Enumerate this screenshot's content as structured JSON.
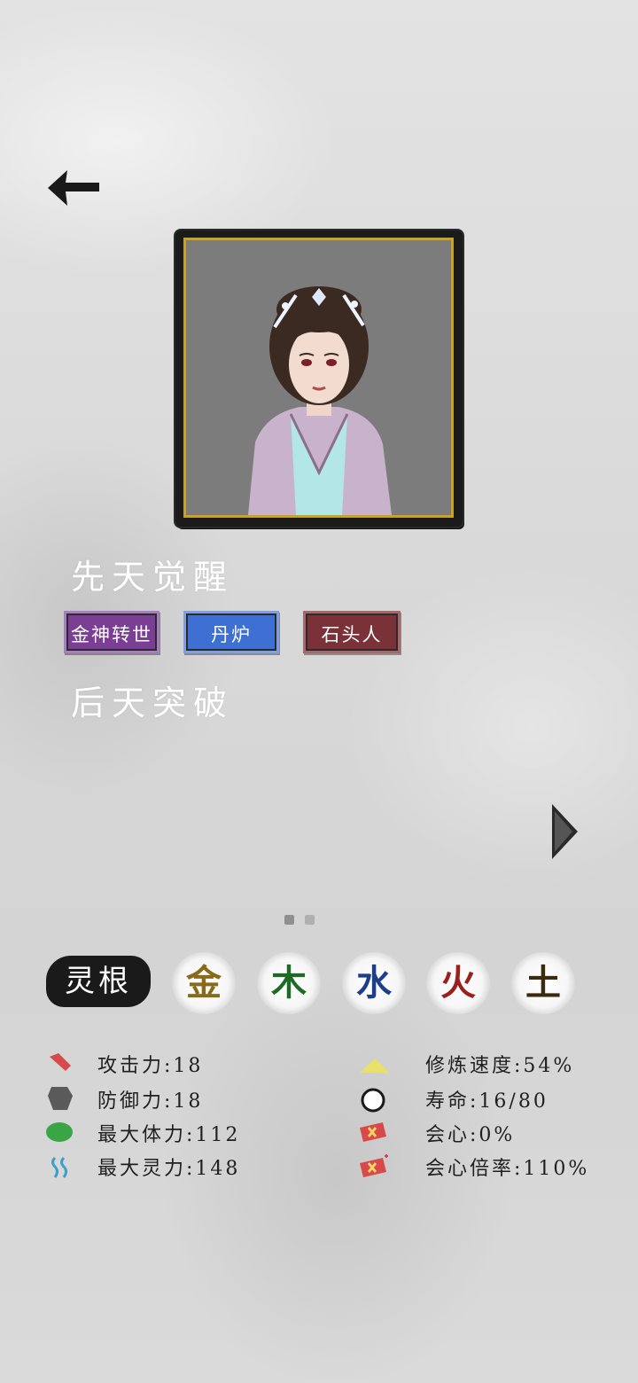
{
  "profile": {
    "innate_title": "先天觉醒",
    "acquired_title": "后天突破",
    "innate_traits": [
      {
        "label": "金神转世",
        "color": "#7a3f95"
      },
      {
        "label": "丹炉",
        "color": "#3e6fd2"
      },
      {
        "label": "石头人",
        "color": "#7a3238"
      }
    ]
  },
  "pager": {
    "current": 1,
    "total": 2
  },
  "spirit_root": {
    "label": "灵根",
    "elements": [
      {
        "char": "金",
        "color": "#8a6a1a"
      },
      {
        "char": "木",
        "color": "#1f6a24"
      },
      {
        "char": "水",
        "color": "#1c3f8c"
      },
      {
        "char": "火",
        "color": "#9a1f1f"
      },
      {
        "char": "土",
        "color": "#3a2a10"
      }
    ]
  },
  "stats": {
    "left": [
      {
        "label": "攻击力:18",
        "icon": "sword-icon",
        "icon_color": "#d84a4a"
      },
      {
        "label": "防御力:18",
        "icon": "shield-icon",
        "icon_color": "#5a5a5a"
      },
      {
        "label": "最大体力:112",
        "icon": "health-icon",
        "icon_color": "#3aa544"
      },
      {
        "label": "最大灵力:148",
        "icon": "spirit-energy-icon",
        "icon_color": "#3aa0c8"
      }
    ],
    "right": [
      {
        "label": "修炼速度:54%",
        "icon": "cultivation-speed-icon",
        "icon_color": "#e9e06a"
      },
      {
        "label": "寿命:16/80",
        "icon": "lifespan-icon",
        "icon_color": "#ffffff"
      },
      {
        "label": "会心:0%",
        "icon": "critical-icon",
        "icon_color": "#d84a4a"
      },
      {
        "label": "会心倍率:110%",
        "icon": "critical-multiplier-icon",
        "icon_color": "#d84a4a"
      }
    ]
  }
}
